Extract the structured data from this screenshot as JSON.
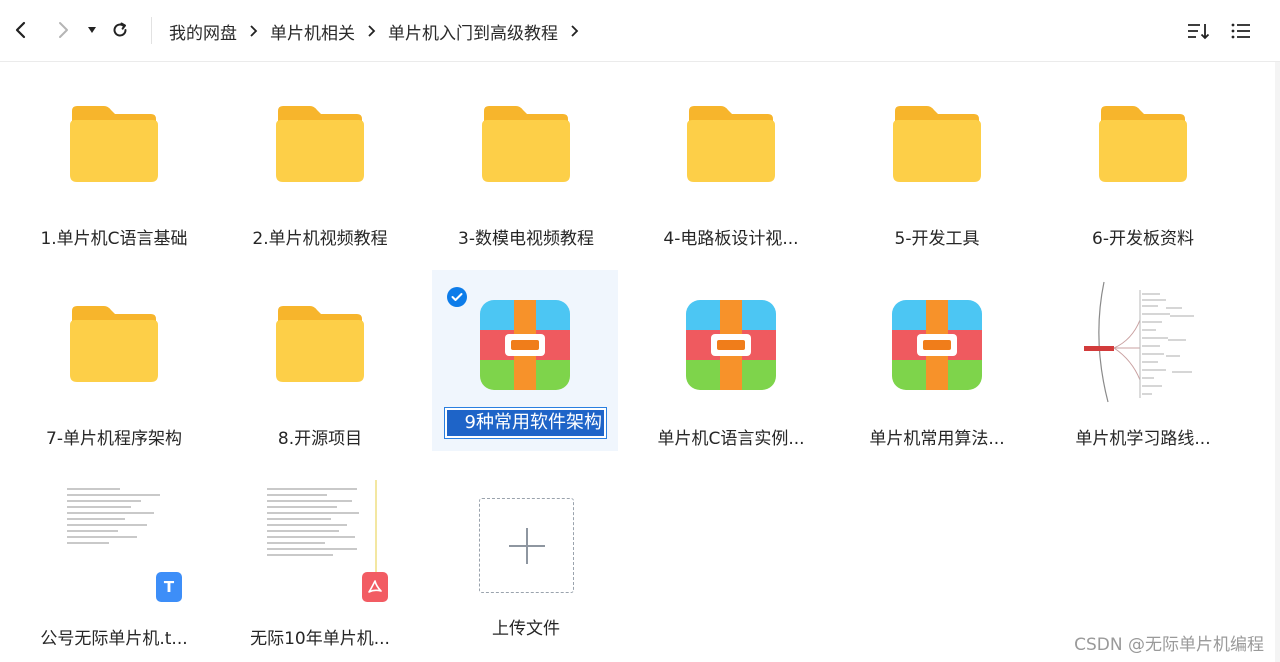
{
  "breadcrumb": [
    "我的网盘",
    "单片机相关",
    "单片机入门到高级教程"
  ],
  "toolbar": {
    "sort_icon": "sort-icon",
    "view_icon": "list-view-icon"
  },
  "items": [
    {
      "name": "1.单片机C语言基础",
      "type": "folder"
    },
    {
      "name": "2.单片机视频教程",
      "type": "folder"
    },
    {
      "name": "3-数模电视频教程",
      "type": "folder"
    },
    {
      "name": "4-电路板设计视...",
      "type": "folder"
    },
    {
      "name": "5-开发工具",
      "type": "folder"
    },
    {
      "name": "6-开发板资料",
      "type": "folder"
    },
    {
      "name": "7-单片机程序架构",
      "type": "folder"
    },
    {
      "name": "8.开源项目",
      "type": "folder"
    },
    {
      "name": "9种常用软件架构",
      "type": "archive",
      "selected": true,
      "renaming": true
    },
    {
      "name": "单片机C语言实例...",
      "type": "archive"
    },
    {
      "name": "单片机常用算法...",
      "type": "archive"
    },
    {
      "name": "单片机学习路线...",
      "type": "image"
    },
    {
      "name": "公号无际单片机.t...",
      "type": "txt"
    },
    {
      "name": "无际10年单片机...",
      "type": "pdf"
    },
    {
      "name": "上传文件",
      "type": "upload"
    }
  ],
  "badges": {
    "txt": "T"
  },
  "watermark": "CSDN @无际单片机编程",
  "colors": {
    "accent": "#0d7ce9",
    "folder": "#fcc63d",
    "pdf": "#f25c63",
    "txt": "#3d8ef8"
  }
}
